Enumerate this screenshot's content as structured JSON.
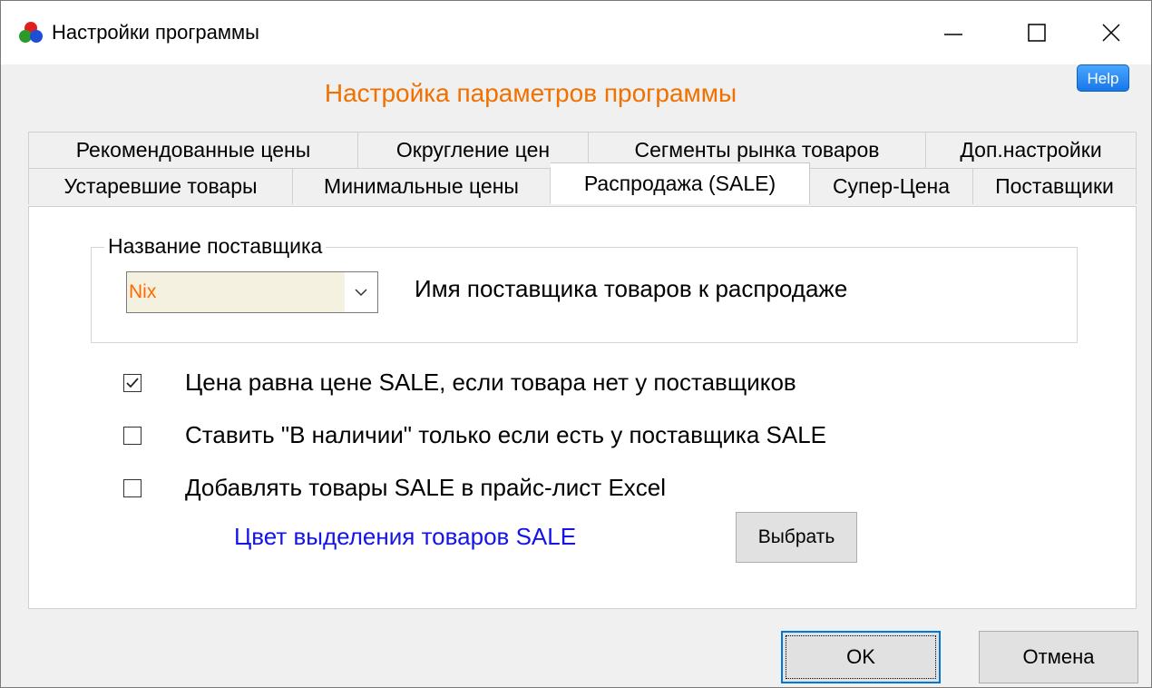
{
  "window": {
    "title": "Настройки программы"
  },
  "header": {
    "title": "Настройка параметров программы",
    "help_label": "Help"
  },
  "tabs": {
    "row1": [
      {
        "label": "Рекомендованные цены"
      },
      {
        "label": "Округление цен"
      },
      {
        "label": "Сегменты рынка товаров"
      },
      {
        "label": "Доп.настройки"
      }
    ],
    "row2": [
      {
        "label": "Устаревшие товары"
      },
      {
        "label": "Минимальные цены"
      },
      {
        "label": "Распродажа (SALE)",
        "active": true
      },
      {
        "label": "Супер-Цена"
      },
      {
        "label": "Поставщики"
      }
    ]
  },
  "supplier_group": {
    "label": "Название поставщика",
    "selected": "Nix",
    "description": "Имя поставщика товаров к распродаже"
  },
  "options": [
    {
      "label": "Цена равна цене SALE, если товара нет у поставщиков",
      "checked": true
    },
    {
      "label": "Ставить \"В наличии\" только если есть у поставщика SALE",
      "checked": false
    },
    {
      "label": "Добавлять товары SALE в прайс-лист Excel",
      "checked": false
    }
  ],
  "highlight": {
    "label": "Цвет выделения товаров SALE",
    "button": "Выбрать"
  },
  "footer": {
    "ok": "OK",
    "cancel": "Отмена"
  },
  "colors": {
    "accent": "#f07000",
    "link_blue": "#1414e6",
    "help_blue": "#1877e8"
  }
}
